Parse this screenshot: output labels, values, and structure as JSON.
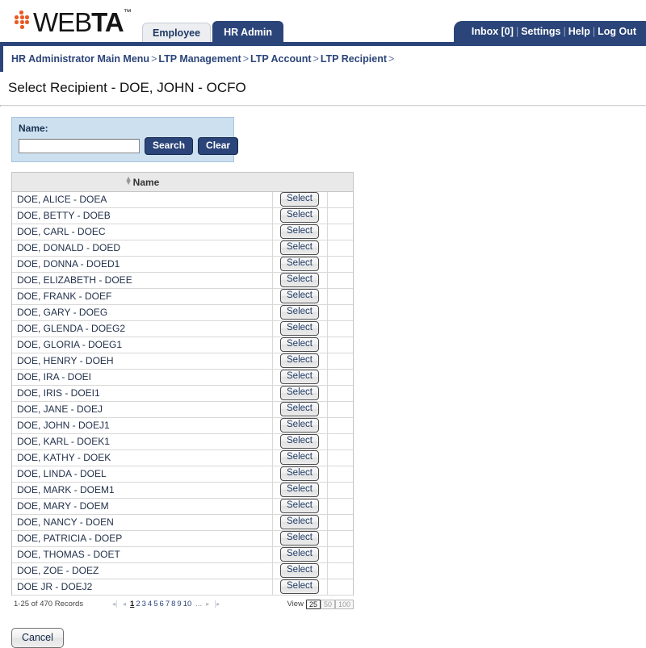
{
  "brand": {
    "name_light": "WEB",
    "name_bold": "TA",
    "trademark": "™",
    "dot_color": "#ea5a24"
  },
  "tabs": [
    {
      "label": "Employee",
      "active": false
    },
    {
      "label": "HR Admin",
      "active": true
    }
  ],
  "util_nav": {
    "inbox": "Inbox [0]",
    "settings": "Settings",
    "help": "Help",
    "logout": "Log Out",
    "separator": "|"
  },
  "breadcrumb": {
    "separator": ">",
    "items": [
      "HR Administrator Main Menu",
      "LTP Management",
      "LTP Account",
      "LTP Recipient"
    ],
    "trailing": ">"
  },
  "page": {
    "title": "Select Recipient - DOE, JOHN - OCFO"
  },
  "search": {
    "label": "Name:",
    "value": "",
    "placeholder": "",
    "search_label": "Search",
    "clear_label": "Clear"
  },
  "table": {
    "columns": [
      "Name",
      "",
      ""
    ],
    "sort_column": "Name",
    "action_label": "Select",
    "rows": [
      {
        "name": "DOE, ALICE - DOEA"
      },
      {
        "name": "DOE, BETTY - DOEB"
      },
      {
        "name": "DOE, CARL - DOEC"
      },
      {
        "name": "DOE, DONALD - DOED"
      },
      {
        "name": "DOE, DONNA - DOED1"
      },
      {
        "name": "DOE, ELIZABETH - DOEE"
      },
      {
        "name": "DOE, FRANK - DOEF"
      },
      {
        "name": "DOE, GARY - DOEG"
      },
      {
        "name": "DOE, GLENDA - DOEG2"
      },
      {
        "name": "DOE, GLORIA - DOEG1"
      },
      {
        "name": "DOE, HENRY - DOEH"
      },
      {
        "name": "DOE, IRA - DOEI"
      },
      {
        "name": "DOE, IRIS - DOEI1"
      },
      {
        "name": "DOE, JANE - DOEJ"
      },
      {
        "name": "DOE, JOHN - DOEJ1"
      },
      {
        "name": "DOE, KARL - DOEK1"
      },
      {
        "name": "DOE, KATHY - DOEK"
      },
      {
        "name": "DOE, LINDA - DOEL"
      },
      {
        "name": "DOE, MARK - DOEM1"
      },
      {
        "name": "DOE, MARY - DOEM"
      },
      {
        "name": "DOE, NANCY - DOEN"
      },
      {
        "name": "DOE, PATRICIA - DOEP"
      },
      {
        "name": "DOE, THOMAS - DOET"
      },
      {
        "name": "DOE, ZOE - DOEZ"
      },
      {
        "name": "DOE JR - DOEJ2"
      }
    ]
  },
  "pagination": {
    "record_summary": "1-25 of 470 Records",
    "first_label": "◂│",
    "prev_label": "◂",
    "next_label": "▸",
    "last_label": "│▸",
    "pages": [
      "1",
      "2",
      "3",
      "4",
      "5",
      "6",
      "7",
      "8",
      "9",
      "10"
    ],
    "current_page": "1",
    "ellipsis": "...",
    "view_label": "View",
    "view_options": [
      "25",
      "50",
      "100"
    ],
    "view_selected": "25"
  },
  "footer": {
    "cancel_label": "Cancel"
  }
}
